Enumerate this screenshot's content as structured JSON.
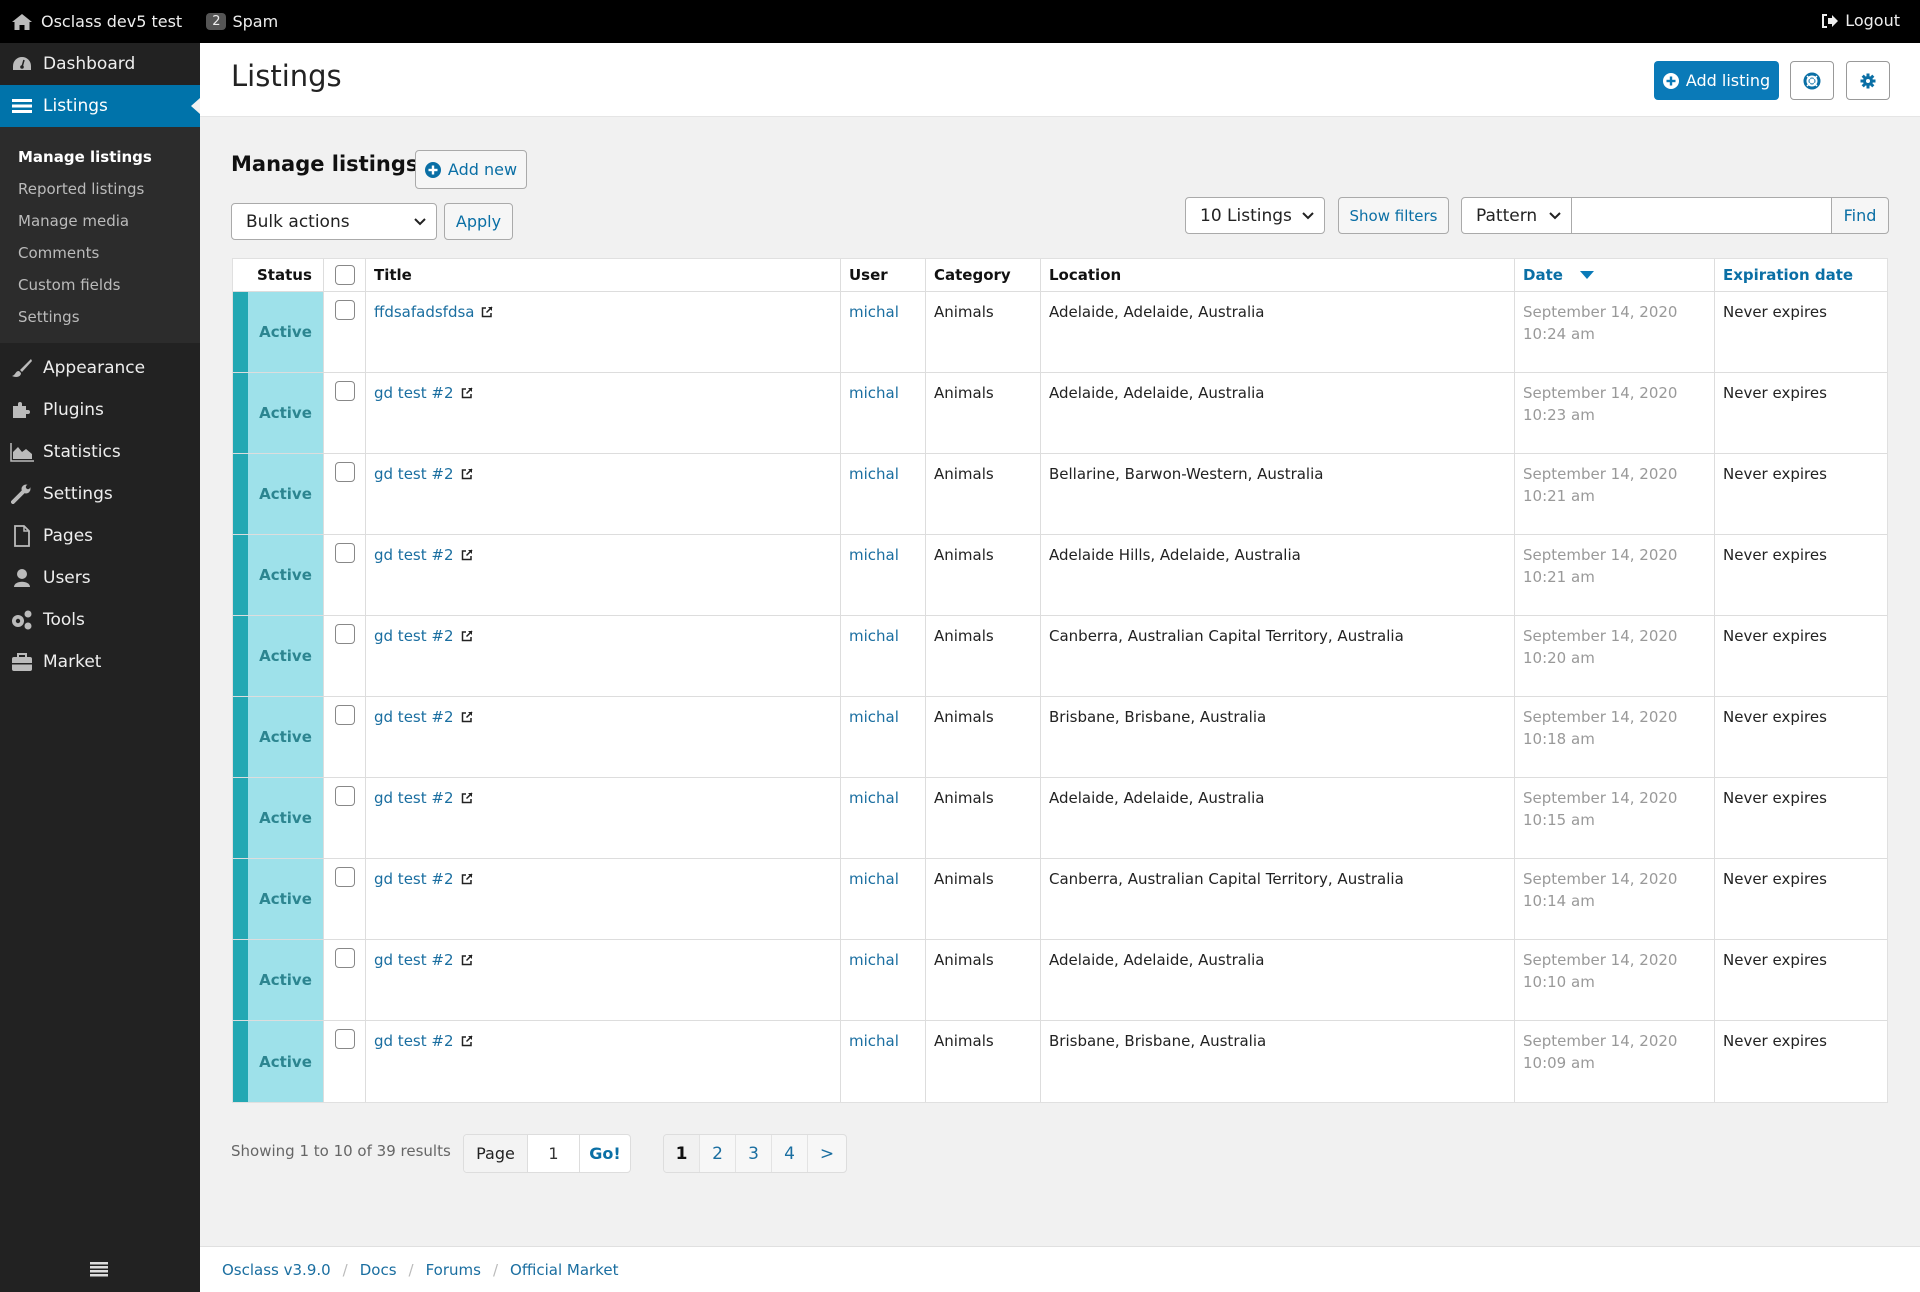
{
  "topbar": {
    "site_name": "Osclass dev5 test",
    "spam_count": "2",
    "spam_label": "Spam",
    "logout_label": "Logout"
  },
  "sidebar": {
    "items_top": [
      {
        "label": "Dashboard",
        "icon": "dashboard-icon"
      },
      {
        "label": "Listings",
        "icon": "list-icon",
        "active": true
      }
    ],
    "submenu": [
      {
        "label": "Manage listings",
        "current": true
      },
      {
        "label": "Reported listings"
      },
      {
        "label": "Manage media"
      },
      {
        "label": "Comments"
      },
      {
        "label": "Custom fields"
      },
      {
        "label": "Settings"
      }
    ],
    "items_bottom": [
      {
        "label": "Appearance",
        "icon": "brush-icon"
      },
      {
        "label": "Plugins",
        "icon": "puzzle-icon"
      },
      {
        "label": "Statistics",
        "icon": "area-chart-icon"
      },
      {
        "label": "Settings",
        "icon": "wrench-icon"
      },
      {
        "label": "Pages",
        "icon": "page-icon"
      },
      {
        "label": "Users",
        "icon": "user-icon"
      },
      {
        "label": "Tools",
        "icon": "gears-icon"
      },
      {
        "label": "Market",
        "icon": "briefcase-icon"
      }
    ]
  },
  "header": {
    "title": "Listings",
    "add_listing_label": "Add listing"
  },
  "content": {
    "title": "Manage listings",
    "add_new_label": "Add new",
    "bulk_actions_value": "Bulk actions",
    "apply_label": "Apply",
    "per_page_value": "10 Listings",
    "show_filters_label": "Show filters",
    "search_type_value": "Pattern",
    "search_value": "",
    "find_label": "Find"
  },
  "table": {
    "columns": {
      "status": "Status",
      "title": "Title",
      "user": "User",
      "category": "Category",
      "location": "Location",
      "date": "Date",
      "expiration": "Expiration date"
    },
    "sort_column": "Date",
    "sort_direction": "desc",
    "rows": [
      {
        "status": "Active",
        "title": "ffdsafadsfdsa",
        "user": "michal",
        "category": "Animals",
        "location": "Adelaide, Adelaide, Australia",
        "date": "September 14, 2020",
        "time": "10:24 am",
        "expiration": "Never expires"
      },
      {
        "status": "Active",
        "title": "gd test #2",
        "user": "michal",
        "category": "Animals",
        "location": "Adelaide, Adelaide, Australia",
        "date": "September 14, 2020",
        "time": "10:23 am",
        "expiration": "Never expires"
      },
      {
        "status": "Active",
        "title": "gd test #2",
        "user": "michal",
        "category": "Animals",
        "location": "Bellarine, Barwon-Western, Australia",
        "date": "September 14, 2020",
        "time": "10:21 am",
        "expiration": "Never expires"
      },
      {
        "status": "Active",
        "title": "gd test #2",
        "user": "michal",
        "category": "Animals",
        "location": "Adelaide Hills, Adelaide, Australia",
        "date": "September 14, 2020",
        "time": "10:21 am",
        "expiration": "Never expires"
      },
      {
        "status": "Active",
        "title": "gd test #2",
        "user": "michal",
        "category": "Animals",
        "location": "Canberra, Australian Capital Territory, Australia",
        "date": "September 14, 2020",
        "time": "10:20 am",
        "expiration": "Never expires"
      },
      {
        "status": "Active",
        "title": "gd test #2",
        "user": "michal",
        "category": "Animals",
        "location": "Brisbane, Brisbane, Australia",
        "date": "September 14, 2020",
        "time": "10:18 am",
        "expiration": "Never expires"
      },
      {
        "status": "Active",
        "title": "gd test #2",
        "user": "michal",
        "category": "Animals",
        "location": "Adelaide, Adelaide, Australia",
        "date": "September 14, 2020",
        "time": "10:15 am",
        "expiration": "Never expires"
      },
      {
        "status": "Active",
        "title": "gd test #2",
        "user": "michal",
        "category": "Animals",
        "location": "Canberra, Australian Capital Territory, Australia",
        "date": "September 14, 2020",
        "time": "10:14 am",
        "expiration": "Never expires"
      },
      {
        "status": "Active",
        "title": "gd test #2",
        "user": "michal",
        "category": "Animals",
        "location": "Adelaide, Adelaide, Australia",
        "date": "September 14, 2020",
        "time": "10:10 am",
        "expiration": "Never expires"
      },
      {
        "status": "Active",
        "title": "gd test #2",
        "user": "michal",
        "category": "Animals",
        "location": "Brisbane, Brisbane, Australia",
        "date": "September 14, 2020",
        "time": "10:09 am",
        "expiration": "Never expires"
      }
    ]
  },
  "pagination": {
    "showing_text": "Showing 1 to 10 of 39 results",
    "page_label": "Page",
    "page_value": "1",
    "go_label": "Go!",
    "pages": [
      "1",
      "2",
      "3",
      "4",
      ">"
    ],
    "current_page": "1"
  },
  "footer": {
    "links": [
      "Osclass v3.9.0",
      "Docs",
      "Forums",
      "Official Market"
    ]
  },
  "colors": {
    "accent": "#0a7ab8",
    "link": "#1a6ea0",
    "status_active_bg": "#9ee1ea",
    "status_active_strip": "#23a8b3",
    "status_active_text": "#2c8590"
  }
}
